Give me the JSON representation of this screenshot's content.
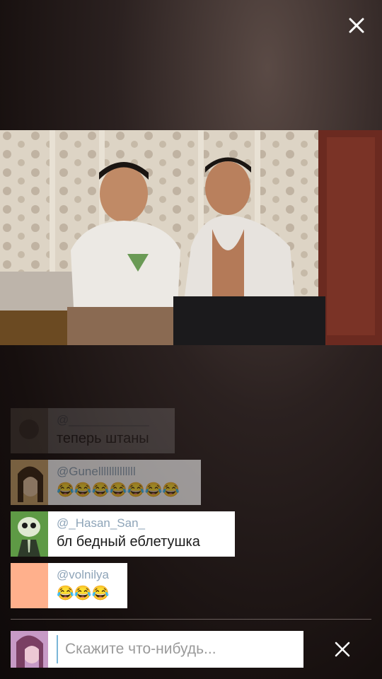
{
  "comments": [
    {
      "user": "@____________",
      "message": "теперь штаны",
      "avatar_color": "#b7a998"
    },
    {
      "user": "@Gunellllllllllllll",
      "message": "😂😂😂😂😂😂😂",
      "avatar_color": "#c9a36b"
    },
    {
      "user": "@_Hasan_San_",
      "message": "бл бедный еблетушка",
      "avatar_color": "#5e9a45"
    },
    {
      "user": "@volnilya",
      "message": "😂😂😂",
      "avatar_color": "#ffb08c"
    }
  ],
  "composer": {
    "placeholder": "Скажите что-нибудь...",
    "avatar_color": "#c79ac6"
  },
  "icons": {
    "close_top": "close-icon",
    "close_bottom": "close-icon"
  },
  "colors": {
    "username": "#8ea4b8",
    "message": "#1a1a1a",
    "background": "#1c1413"
  }
}
